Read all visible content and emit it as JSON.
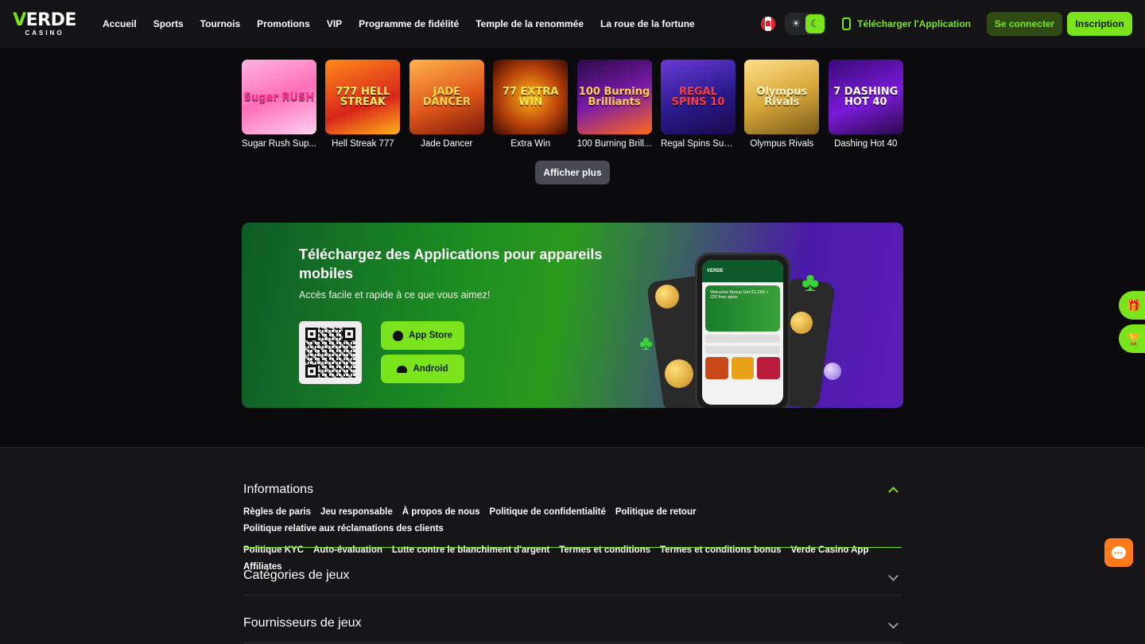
{
  "logo": {
    "main_prefix": "V",
    "main_rest": "ERDE",
    "sub": "CASINO"
  },
  "nav": [
    "Accueil",
    "Sports",
    "Tournois",
    "Promotions",
    "VIP",
    "Programme de fidélité",
    "Temple de la renommée",
    "La roue de la fortune"
  ],
  "header": {
    "download_app": "Télécharger l'Application",
    "login": "Se connecter",
    "register": "Inscription",
    "sun": "☀",
    "moon": "☾"
  },
  "games": [
    {
      "name": "Sugar Rush Sup...",
      "art": "Sugar RUSH",
      "bg": "linear-gradient(160deg,#ffb3e0,#ff6fb8 50%,#ffd1f0)",
      "color": "#ff2d8c"
    },
    {
      "name": "Hell Streak 777",
      "art": "777 HELL STREAK",
      "bg": "linear-gradient(160deg,#ff8a1a,#d8261a 60%,#ffb31a)",
      "color": "#ffef5a"
    },
    {
      "name": "Jade Dancer",
      "art": "JADE DANCER",
      "bg": "linear-gradient(160deg,#ffb34a,#e0571a 55%,#7a1a0a)",
      "color": "#ffd94a"
    },
    {
      "name": "Extra Win",
      "art": "77 EXTRA WIN",
      "bg": "radial-gradient(circle,#ffb31a,#b8420a 55%,#3a0a02)",
      "color": "#ffe84a"
    },
    {
      "name": "100 Burning Brill...",
      "art": "100 Burning Brilliants",
      "bg": "linear-gradient(160deg,#2a0a4a,#7a1aa8 50%,#ff6a1a)",
      "color": "#ffd24a"
    },
    {
      "name": "Regal Spins Sun ...",
      "art": "REGAL SPINS 10",
      "bg": "linear-gradient(160deg,#6a3ad8,#2a1a8a 55%,#1a0a4a)",
      "color": "#ff3a3a"
    },
    {
      "name": "Olympus Rivals",
      "art": "Olympus Rivals",
      "bg": "linear-gradient(160deg,#ffe08a,#d8a83a 50%,#7a5a1a)",
      "color": "#fff6c8"
    },
    {
      "name": "Dashing Hot 40",
      "art": "7 DASHING HOT 40",
      "bg": "linear-gradient(160deg,#3a0a7a,#7a1ad8 55%,#2a0a4a)",
      "color": "#ffffff"
    }
  ],
  "show_more": "Afficher plus",
  "banner": {
    "title": "Téléchargez des Applications pour appareils mobiles",
    "subtitle": "Accès facile et rapide à ce que vous aimez!",
    "app_store": "App Store",
    "android": "Android",
    "phone": {
      "top": "VERDE",
      "hero": "Welcome Bonus Get €1,200 + 220 free spins"
    }
  },
  "footer": {
    "informations": {
      "title": "Informations",
      "links": [
        "Règles de paris",
        "Jeu responsable",
        "À propos de nous",
        "Politique de confidentialité",
        "Politique de retour",
        "Politique relative aux réclamations des clients",
        "Politique KYC",
        "Auto-évaluation",
        "Lutte contre le blanchiment d'argent",
        "Termes et conditions",
        "Termes et conditions bonus",
        "Verde Casino App",
        "Affiliates"
      ]
    },
    "categories": "Catégories de jeux",
    "providers": "Fournisseurs de jeux"
  },
  "colors": {
    "accent": "#7be31c",
    "chat": "#ff7a1a",
    "background": "#0b0b0d"
  }
}
